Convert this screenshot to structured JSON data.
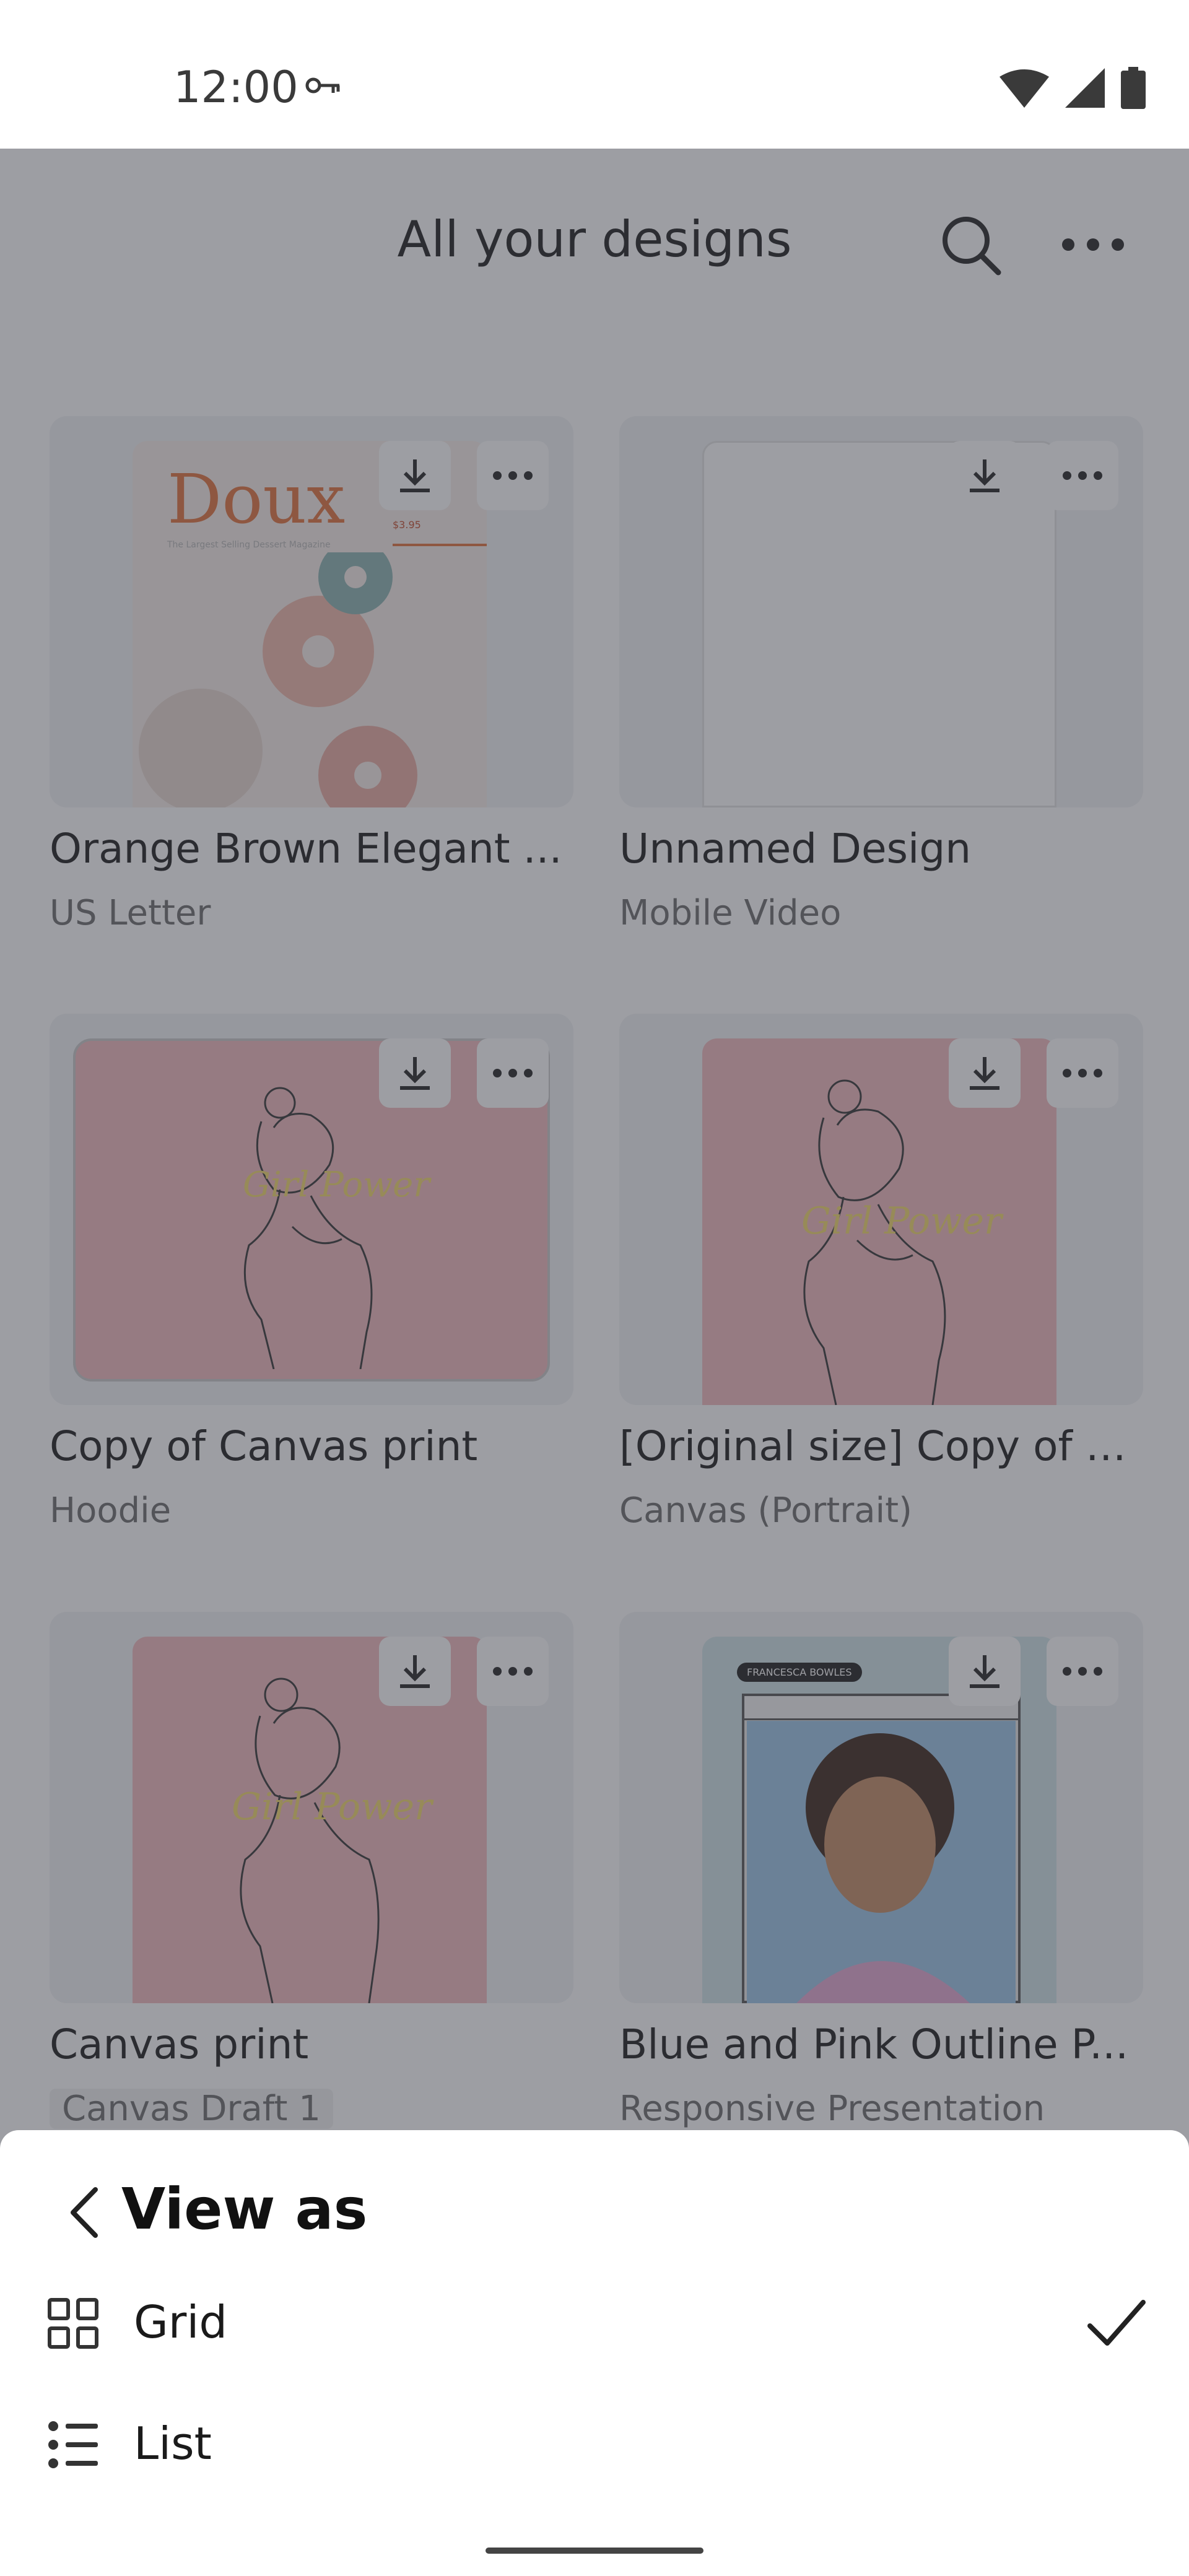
{
  "status_bar": {
    "time": "12:00"
  },
  "header": {
    "title": "All your designs"
  },
  "designs": [
    {
      "title": "Orange Brown Elegant ...",
      "subtitle": "US Letter",
      "thumb_text": "Doux",
      "thumb_sub": "The Largest Selling Dessert Magazine",
      "price": "$3.95"
    },
    {
      "title": "Unnamed Design",
      "subtitle": "Mobile Video"
    },
    {
      "title": "Copy of Canvas print",
      "subtitle": "Hoodie",
      "script_text": "Girl Power"
    },
    {
      "title": "[Original size] Copy of C...",
      "subtitle": "Canvas (Portrait)",
      "script_text": "Girl Power"
    },
    {
      "title": "Canvas print",
      "subtitle": "Canvas Draft 1",
      "script_text": "Girl Power"
    },
    {
      "title": "Blue and Pink Outline P...",
      "subtitle": "Responsive Presentation",
      "badge": "FRANCESCA BOWLES"
    }
  ],
  "sheet": {
    "title": "View as",
    "options": [
      {
        "label": "Grid",
        "selected": true,
        "icon": "grid-icon"
      },
      {
        "label": "List",
        "selected": false,
        "icon": "list-icon"
      }
    ]
  },
  "colors": {
    "scrim": "#3c3e48",
    "pink_thumb": "#f0b9bd",
    "orange_brand": "#e0703a"
  }
}
